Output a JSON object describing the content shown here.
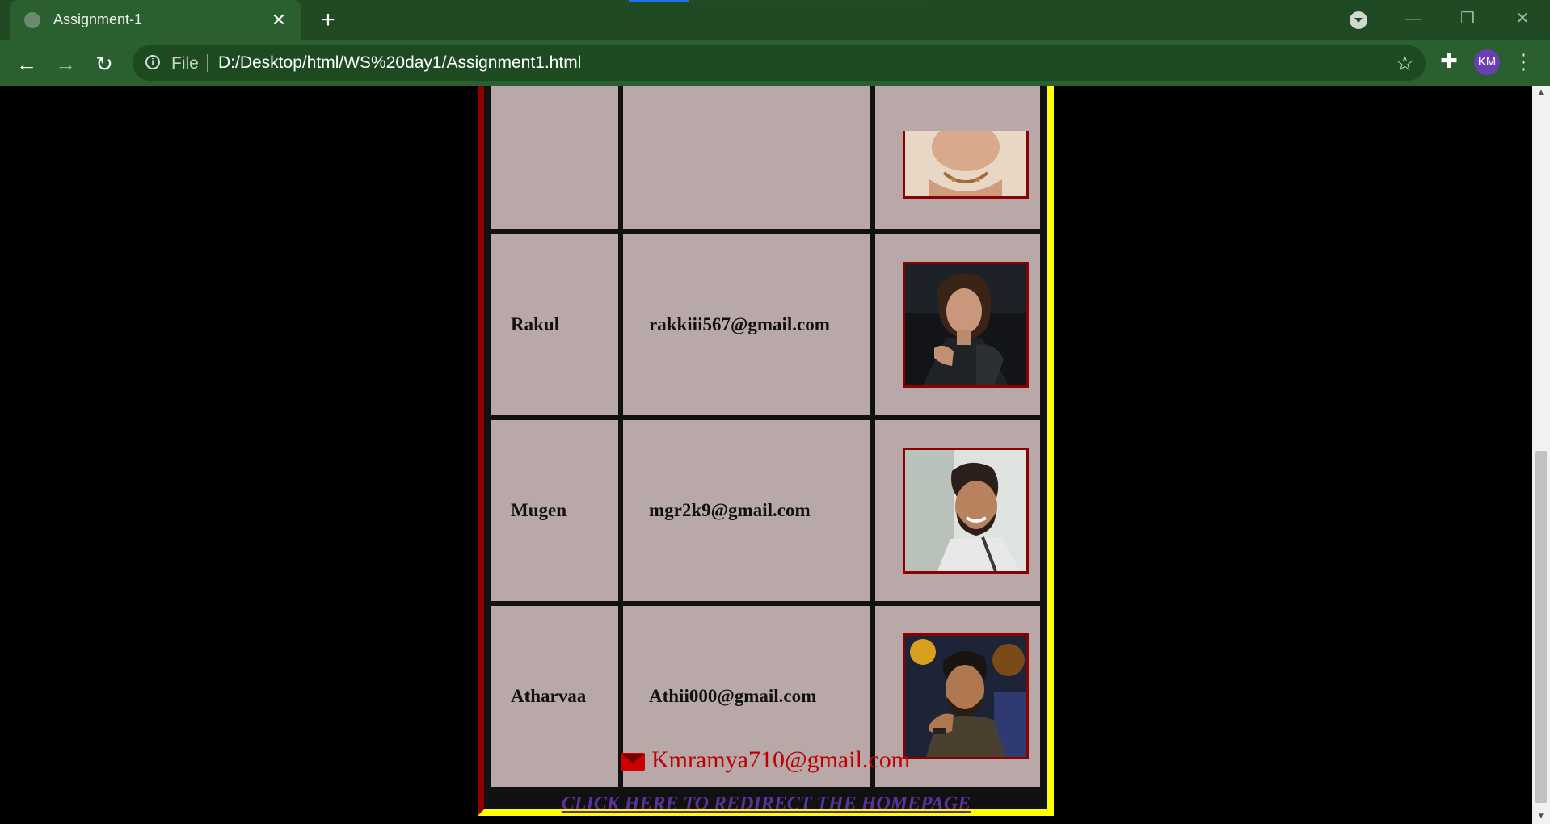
{
  "browser": {
    "tab_title": "Assignment-1",
    "scheme_label": "File",
    "url": "D:/Desktop/html/WS%20day1/Assignment1.html",
    "profile_initials": "KM"
  },
  "table": {
    "rows": [
      {
        "name": "",
        "email": "",
        "photo": "partial-portrait-photo"
      },
      {
        "name": "Rakul",
        "email": "rakkiii567@gmail.com",
        "photo": "portrait-photo-rakul"
      },
      {
        "name": "Mugen",
        "email": "mgr2k9@gmail.com",
        "photo": "portrait-photo-mugen"
      },
      {
        "name": "Atharvaa",
        "email": "Athii000@gmail.com",
        "photo": "portrait-photo-atharvaa"
      }
    ]
  },
  "footer": {
    "contact_email": "Kmramya710@gmail.com",
    "redirect_link": "CLICK HERE TO REDIRECT THE HOMEPAGE"
  },
  "colors": {
    "chrome": "#2a6030",
    "cell_bg": "#b8a8a8",
    "frame_left": "#8b0000",
    "frame_right": "#ffff00",
    "email_text": "#c00000",
    "link": "#5a32a0"
  }
}
